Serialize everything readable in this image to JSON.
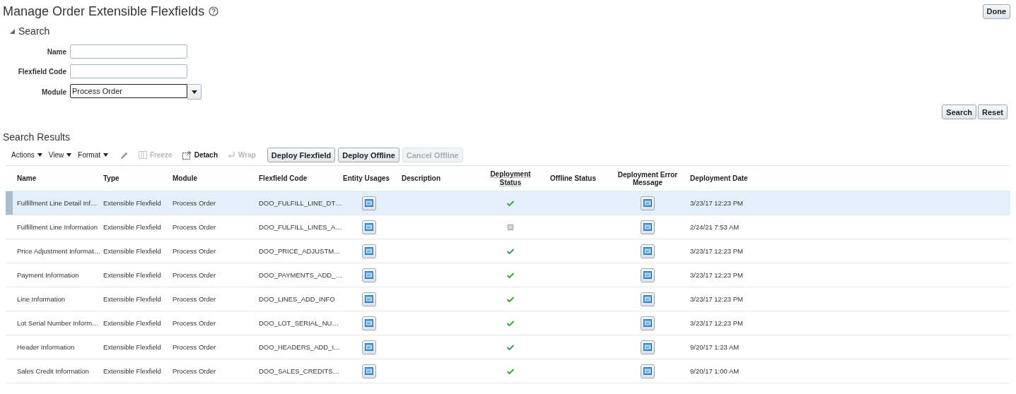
{
  "page": {
    "title": "Manage Order Extensible Flexfields",
    "done_button": "Done"
  },
  "search": {
    "title": "Search",
    "expanded": true,
    "fields": [
      {
        "label": "Name",
        "kind": "text"
      },
      {
        "label": "Flexfield Code",
        "kind": "text"
      },
      {
        "label": "Module",
        "kind": "select",
        "value": "Process Order"
      }
    ],
    "buttons": [
      "Search",
      "Reset"
    ]
  },
  "results": {
    "title": "Search Results",
    "menus": [
      "Actions",
      "View",
      "Format"
    ],
    "tools": [
      {
        "label": "Freeze",
        "kind": "freeze",
        "disabled": true
      },
      {
        "label": "Detach",
        "kind": "detach",
        "disabled": false
      },
      {
        "label": "Wrap",
        "kind": "wrap",
        "disabled": true
      }
    ],
    "buttons": [
      {
        "label": "Deploy Flexfield",
        "disabled": false
      },
      {
        "label": "Deploy Offline",
        "disabled": false
      },
      {
        "label": "Cancel Offline",
        "disabled": true
      }
    ],
    "columns": [
      "Name",
      "Type",
      "Module",
      "Flexfield Code",
      "Entity Usages",
      "Description",
      "Deployment Status",
      "Offline Status",
      "Deployment Error Message",
      "Deployment Date"
    ],
    "rows": [
      {
        "name": "Fulfillment Line Detail Inf…",
        "type": "Extensible Flexfield",
        "module": "Process Order",
        "code": "DOO_FULFILL_LINE_DT…",
        "deployed": true,
        "date": "3/23/17 12:23 PM",
        "selected": true
      },
      {
        "name": "Fulfillment Line Information",
        "type": "Extensible Flexfield",
        "module": "Process Order",
        "code": "DOO_FULFILL_LINES_A…",
        "deployed": false,
        "date": "2/24/21 7:53 AM",
        "selected": false
      },
      {
        "name": "Price Adjustment Informat…",
        "type": "Extensible Flexfield",
        "module": "Process Order",
        "code": "DOO_PRICE_ADJUSTM…",
        "deployed": true,
        "date": "3/23/17 12:23 PM",
        "selected": false
      },
      {
        "name": "Payment Information",
        "type": "Extensible Flexfield",
        "module": "Process Order",
        "code": "DOO_PAYMENTS_ADD_…",
        "deployed": true,
        "date": "3/23/17 12:23 PM",
        "selected": false
      },
      {
        "name": "Line Information",
        "type": "Extensible Flexfield",
        "module": "Process Order",
        "code": "DOO_LINES_ADD_INFO",
        "deployed": true,
        "date": "3/23/17 12:23 PM",
        "selected": false
      },
      {
        "name": "Lot Serial Number Inform…",
        "type": "Extensible Flexfield",
        "module": "Process Order",
        "code": "DOO_LOT_SERIAL_NU…",
        "deployed": true,
        "date": "3/23/17 12:23 PM",
        "selected": false
      },
      {
        "name": "Header Information",
        "type": "Extensible Flexfield",
        "module": "Process Order",
        "code": "DOO_HEADERS_ADD_I…",
        "deployed": true,
        "date": "9/20/17 1:23 AM",
        "selected": false
      },
      {
        "name": "Sales Credit Information",
        "type": "Extensible Flexfield",
        "module": "Process Order",
        "code": "DOO_SALES_CREDITS…",
        "deployed": true,
        "date": "9/20/17 1:00 AM",
        "selected": false
      }
    ]
  }
}
